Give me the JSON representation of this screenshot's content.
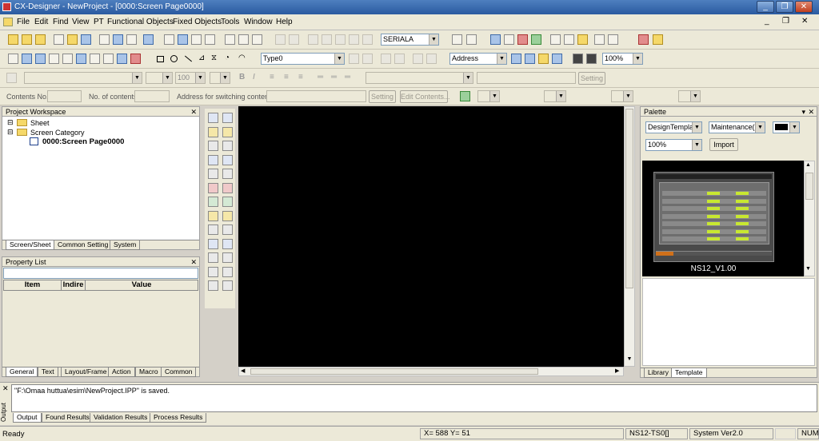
{
  "window": {
    "title": "CX-Designer - NewProject - [0000:Screen Page0000]",
    "minimize": "_",
    "maximize": "❐",
    "close": "✕"
  },
  "menu": {
    "items": [
      "File",
      "Edit",
      "Find",
      "View",
      "PT",
      "Functional Objects",
      "Fixed Objects",
      "Tools",
      "Window",
      "Help"
    ],
    "mdi_minimize": "_",
    "mdi_restore": "❐",
    "mdi_close": "✕"
  },
  "toolbar1": {
    "serial_value": "SERIALA"
  },
  "toolbar2": {
    "type_value": "Type0",
    "address_value": "Address",
    "zoom_value": "100%"
  },
  "toolbar3": {
    "font_size": "100",
    "setting_label": "Setting"
  },
  "toolbar4": {
    "contents_no_label": "Contents No.",
    "no_of_contents_label": "No. of contents",
    "address_switch_label": "Address for switching contents",
    "setting_label": "Setting",
    "edit_contents_label": "Edit Contents..."
  },
  "workspace": {
    "title": "Project Workspace",
    "close": "✕",
    "tree": [
      {
        "label": "Sheet",
        "bold": false
      },
      {
        "label": "Screen Category",
        "bold": false
      },
      {
        "label": "0000:Screen Page0000",
        "bold": true
      }
    ],
    "tabs": [
      "Screen/Sheet",
      "Common Setting",
      "System"
    ]
  },
  "property": {
    "title": "Property List",
    "close": "✕",
    "columns": [
      "Item",
      "Indire",
      "Value"
    ],
    "tabs": [
      "General",
      "Text",
      "Layout/Frame",
      "Action",
      "Macro",
      "Common"
    ]
  },
  "objects_palette": {
    "icons": [
      [
        "PB",
        "W"
      ],
      [
        "IND",
        "B"
      ],
      [
        "W",
        "MF"
      ],
      [
        "ABC",
        "123"
      ],
      [
        "XYZ",
        "LIST"
      ],
      [
        "SEL",
        "PIE"
      ],
      [
        "BAR",
        "GRAPH"
      ],
      [
        "LAMP",
        "DATE"
      ],
      [
        "TIME",
        "DOT"
      ],
      [
        "TABLE",
        "COLOR"
      ],
      [
        "GRAPH2",
        "LINE"
      ],
      [
        "DOC",
        "COPY"
      ],
      [
        "FRAME",
        "GRID"
      ]
    ]
  },
  "palette": {
    "title": "Palette",
    "pin": "▾",
    "close": "✕",
    "category_value": "DesignTemplat",
    "template_value": "Maintenance(C",
    "zoom_value": "100%",
    "import_label": "Import",
    "thumbnail_caption": "NS12_V1.00",
    "tabs": [
      "Library",
      "Template"
    ]
  },
  "output": {
    "title": "Output",
    "message": "\"F:\\Omaa huttua\\esim\\NewProject.IPP\" is saved.",
    "tabs": [
      "Output",
      "Found Results",
      "Validation Results",
      "Process Results"
    ]
  },
  "status": {
    "ready": "Ready",
    "coords": "X= 588 Y=  51",
    "pt_model": "NS12-TS0[]",
    "system_ver": "System Ver2.0",
    "num": "NUM"
  },
  "colors": {
    "canvas": "#000000",
    "titlebar": "#3a6ab0",
    "chrome": "#ece9d8"
  }
}
